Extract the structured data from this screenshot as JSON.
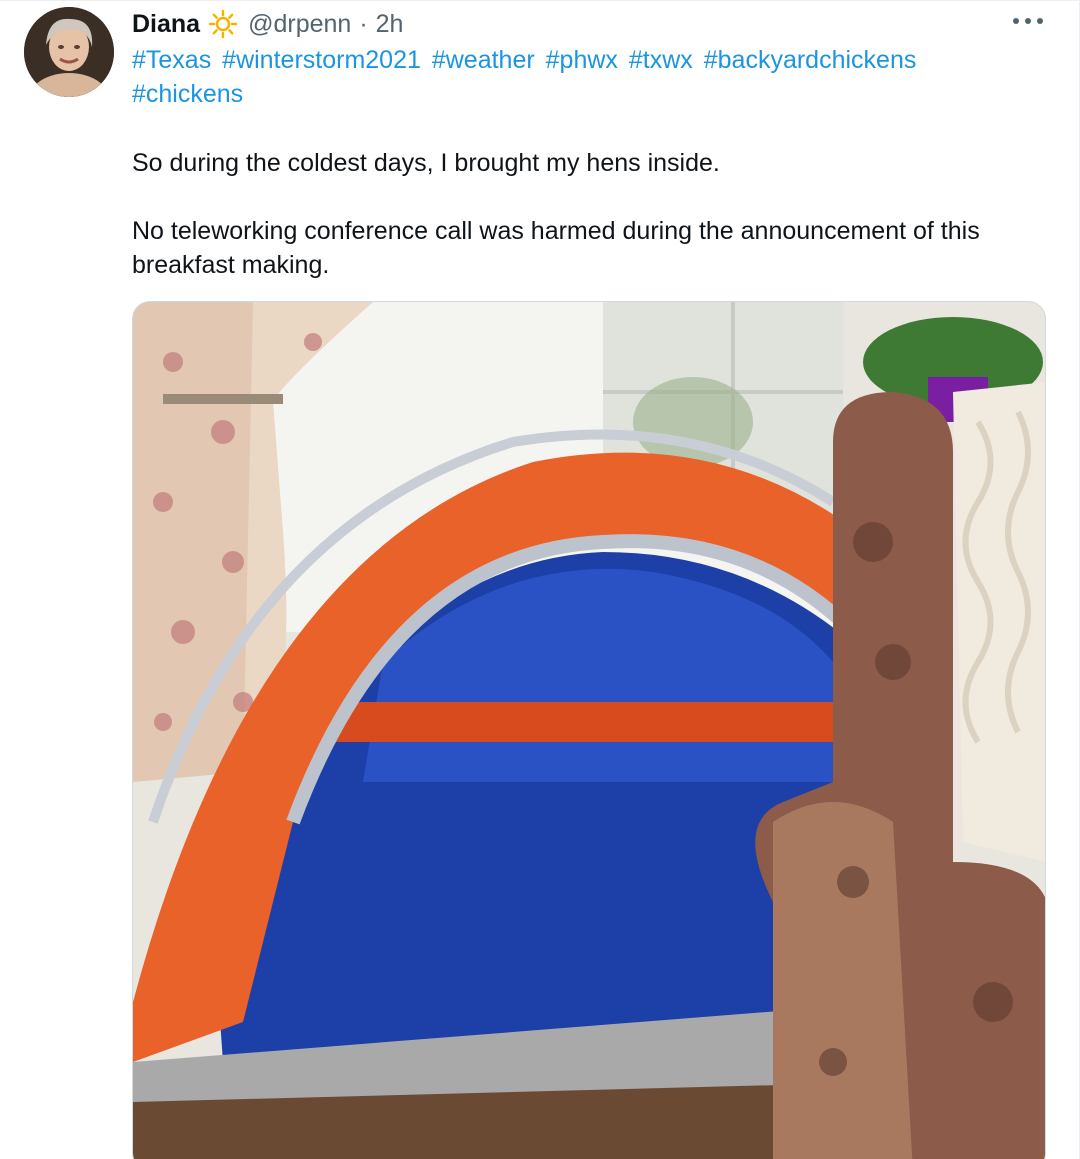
{
  "tweet": {
    "author_name": "Diana",
    "handle": "@drpenn",
    "separator": "·",
    "time": "2h",
    "hashtags": [
      "#Texas",
      "#winterstorm2021",
      "#weather",
      "#phwx",
      "#txwx",
      "#backyardchickens",
      "#chickens"
    ],
    "paragraph1": "So during the coldest days, I brought my hens inside.",
    "paragraph2": "No teleworking conference call was harmed during the announcement of this breakfast making."
  },
  "icons": {
    "badge": "sun-icon",
    "menu": "more-icon"
  },
  "colors": {
    "link": "#1b95e0",
    "secondary_text": "#536471",
    "tent_orange": "#e8622a",
    "tent_blue": "#1c3fa8"
  }
}
